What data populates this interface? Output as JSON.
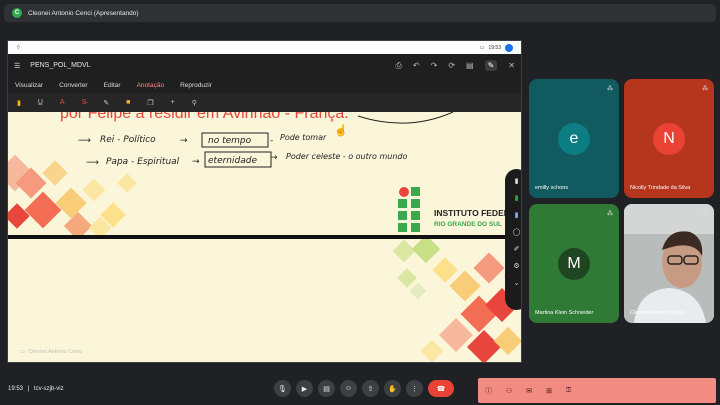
{
  "presenter_banner": "Cleonei Antonio Cenci (Apresentando)",
  "presenter_initial": "C",
  "device": {
    "time": "19:53"
  },
  "app": {
    "doc_title": "PENS_POL_MDVL",
    "tabs": [
      {
        "label": "Visualizar"
      },
      {
        "label": "Converter"
      },
      {
        "label": "Editar"
      },
      {
        "label": "Anotação"
      },
      {
        "label": "Reproduzir"
      }
    ],
    "active_tab": "Anotação"
  },
  "note": {
    "top_line": "por Felipe a residir em Avinhão - França.",
    "line1_a": "Rei - Político",
    "line1_box": "no tempo",
    "line1_c": "Pode tomar",
    "line2_a": "Papa - Espiritual",
    "line2_box": "eternidade",
    "line2_c": "Poder celeste - o outro mundo"
  },
  "logo": {
    "line1": "INSTITUTO FEDERAL",
    "line2": "RIO GRANDE DO SUL"
  },
  "watermark": "Cleonei Antonio Cenci",
  "participants": [
    {
      "name": "emilly schons",
      "initial": "e",
      "avatar_color": "#0b7d83"
    },
    {
      "name": "Nicolly Trindade da Silva",
      "initial": "N",
      "avatar_color": "#ea4335"
    },
    {
      "name": "Martina Klein Schneider",
      "initial": "M",
      "avatar_color": "#1e4620"
    },
    {
      "name": "Cleonei Antonio Cenci",
      "initial": "",
      "avatar_color": "#9ea4a3"
    }
  ],
  "bottom": {
    "time": "19:53",
    "separator": "|",
    "meeting_code": "tcv-szjb-viz"
  },
  "colors": {
    "background": "#202124",
    "accent_panel": "#f28b82",
    "end_call": "#ea4335",
    "raise_hand": "#8ab4f8"
  }
}
